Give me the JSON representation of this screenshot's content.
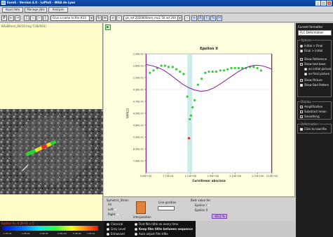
{
  "window": {
    "title": "EuroS - Version 4.0 - LaPtoS - INSA de Lyon",
    "buttons": [
      "_",
      "□",
      "×"
    ]
  },
  "menu": [
    "Input data",
    "Manage jobs",
    "Analysis"
  ],
  "toolbar": {
    "left_buttons": [
      "P",
      "←",
      "→"
    ],
    "dropdown1": "Give a name to file #23",
    "dropdown2": "pk_ref 2050000mm_mx1 50 ref 200",
    "right_buttons": [
      "+",
      "R",
      "t",
      "%",
      "H"
    ]
  },
  "left": {
    "caption": "80x80mm_00/10 Img 7(36/924)"
  },
  "chart_data": {
    "type": "scatter",
    "title": "Epsilon II",
    "xlabel": "Curvilinear abscissa",
    "ylabel": "STRAIN",
    "xlim": [
      0.0,
      3.1
    ],
    "ylim": [
      -7.0,
      3.0
    ],
    "xtick_labels": [
      "0.00E+00",
      "7.70E-01",
      "1.10E+00",
      "1.90E+00",
      "2.10E+00",
      "2.70E+00",
      "3.10E+00"
    ],
    "xtick_values": [
      0.0,
      0.55,
      1.1,
      1.65,
      2.2,
      2.75,
      3.1
    ],
    "ytick_labels": [
      "2.90E-01",
      "2.85E-01",
      "2.50E-01",
      "4.30E-01",
      "4.75E-01",
      "4.50E-01",
      "4.80E-01",
      "5.30E-01",
      "6.50E-01",
      "7.00E-01"
    ],
    "ytick_values": [
      3.0,
      2.0,
      1.0,
      0.0,
      -1.0,
      -2.0,
      -3.0,
      -4.0,
      -5.0,
      -6.0
    ],
    "grid": false,
    "highlight_x_range": [
      1.02,
      1.14
    ],
    "vertical_lines": [
      0.0,
      3.1
    ],
    "series": [
      {
        "marker": "point",
        "color": "#2fd12f",
        "x": [
          0.1,
          0.19,
          0.28,
          0.38,
          0.47,
          0.56,
          0.66,
          0.75,
          0.84,
          0.93,
          1.02,
          1.08,
          1.11,
          1.15,
          1.2,
          1.28,
          1.37,
          1.46,
          1.55,
          1.64,
          1.73,
          1.83,
          1.92,
          2.01,
          2.1,
          2.19,
          2.28,
          2.37,
          2.46,
          2.56,
          2.65,
          2.74,
          2.83
        ],
        "y": [
          1.4,
          1.6,
          1.8,
          2.0,
          2.0,
          1.9,
          1.9,
          1.7,
          1.5,
          1.3,
          -0.6,
          -2.5,
          -2.2,
          -1.5,
          -0.9,
          0.4,
          0.9,
          1.4,
          1.5,
          1.5,
          1.5,
          1.6,
          1.6,
          1.7,
          1.8,
          1.8,
          1.8,
          1.8,
          1.8,
          1.9,
          1.9,
          1.8,
          1.6
        ]
      },
      {
        "marker": "point",
        "color": "#e82020",
        "x": [
          1.06
        ],
        "y": [
          -4.1
        ]
      },
      {
        "marker": "line",
        "color": "#8a2a9a",
        "x": [
          0.0,
          0.15,
          0.3,
          0.45,
          0.6,
          0.75,
          0.9,
          1.05,
          1.2,
          1.35,
          1.5,
          1.65,
          1.8,
          1.95,
          2.1,
          2.25,
          2.4,
          2.55,
          2.7,
          2.85,
          3.0,
          3.1
        ],
        "y": [
          2.1,
          2.0,
          1.85,
          1.6,
          1.25,
          0.85,
          0.45,
          0.15,
          -0.05,
          -0.15,
          -0.1,
          0.1,
          0.4,
          0.75,
          1.1,
          1.45,
          1.75,
          1.95,
          2.05,
          2.0,
          1.85,
          1.7
        ]
      }
    ]
  },
  "bottom": {
    "symmetry_label": "Symetric_Strain",
    "symmetry_options": [
      "All",
      "Left",
      "Right"
    ],
    "image_label": "Interpolation",
    "line_position_label": "Line position",
    "best_value_label": "Best value for:",
    "best_options": [
      "Epsilon I",
      "Epsilon II"
    ],
    "best_value": "-43.2 %"
  },
  "right": {
    "title": "Current formatter",
    "dropdown": "FLC Deformation",
    "options_label": "Options",
    "radios": [
      {
        "label": "Initial > Final",
        "on": true
      },
      {
        "label": "Final > Initial",
        "on": false
      }
    ],
    "checks": [
      {
        "label": "Show Reference",
        "on": true
      },
      {
        "label": "Show tool base",
        "on": true
      },
      {
        "label": "on initial picture",
        "on": true,
        "radio": true
      },
      {
        "label": "on final picture",
        "on": false,
        "radio": true
      },
      {
        "label": "Show Picture",
        "on": true
      },
      {
        "label": "Show Bad Pattern",
        "on": false
      }
    ],
    "section2_label": "Display",
    "checks2": [
      {
        "label": "Amplification",
        "on": true
      },
      {
        "label": "Substract mean",
        "on": true
      },
      {
        "label": "Smoothing",
        "on": true
      }
    ],
    "section3_label": "Deformation",
    "checks3": [
      {
        "label": "Click to load file",
        "on": false
      }
    ]
  },
  "colorbar": {
    "label": "Epsilon II=-4.2E-01 ± 5",
    "ticks": [
      "-1.5E-01",
      "-1.0E-01",
      "-5.0E-02",
      "0.0E+00",
      "5.0E-02",
      "1.0E-01"
    ]
  },
  "bottom_controls": {
    "left": [
      {
        "label": "Classical",
        "on": true
      },
      {
        "label": "Grey Level",
        "on": false
      },
      {
        "label": "Enhanced",
        "on": false
      }
    ],
    "right": [
      {
        "label": "Find film tiltle on every time",
        "on": false
      },
      {
        "label": "Keep film tiltle between sequence",
        "on": true
      },
      {
        "label": "Auto adjust film tiltle",
        "on": false
      }
    ]
  }
}
